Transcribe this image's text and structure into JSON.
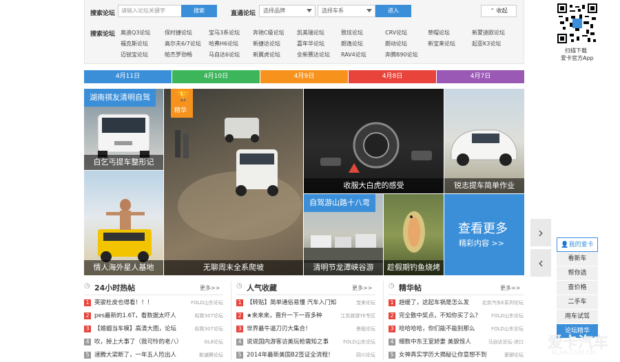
{
  "search": {
    "label": "搜索论坛",
    "placeholder": "请输入论坛关键字",
    "button": "搜索",
    "direct_label": "直通论坛",
    "brand_select": "选择品牌",
    "series_select": "选择车系",
    "enter_button": "进入",
    "collapse": "收起"
  },
  "recommend": {
    "label": "推荐论坛",
    "rows": [
      [
        "奥迪Q3论坛",
        "保时捷论坛",
        "宝马3系论坛",
        "奔驰C级论坛",
        "凯美瑞论坛",
        "致炫论坛",
        "CRV论坛",
        "草帽论坛",
        "新蒙迪欧论坛"
      ],
      [
        "福克斯论坛",
        "高尔夫6/7论坛",
        "哈弗H6论坛",
        "新捷达论坛",
        "嘉年华论坛",
        "朗逸论坛",
        "朗动论坛",
        "新宝来论坛",
        "起亚K3论坛"
      ],
      [
        "迈锐宝论坛",
        "帕杰罗劲畅",
        "马自达6论坛",
        "新翼虎论坛",
        "全新赛达论坛",
        "RAV4论坛",
        "奔腾B90论坛"
      ]
    ]
  },
  "qr": {
    "line1": "扫描下载",
    "line2": "爱卡官方App"
  },
  "date_tabs": [
    {
      "label": "4月11日",
      "color": "#3b8fd9"
    },
    {
      "label": "4月10日",
      "color": "#3cb55b"
    },
    {
      "label": "4月9日",
      "color": "#f7931d"
    },
    {
      "label": "4月8日",
      "color": "#e8443c"
    },
    {
      "label": "4月7日",
      "color": "#9b59b6"
    }
  ],
  "tiles": {
    "t1_label": "湖南祺友清明自驾",
    "t1_caption": "白乞丐提车整形记",
    "t2_caption": "情人海外星人基地",
    "t3_badge": "精华",
    "t3_caption": "无聊周末全系爬坡",
    "t4_caption": "收服大白虎的感受",
    "t5_caption": "锐志提车简单作业",
    "t6_label": "自驾游山路十八弯",
    "t6_caption": "清明节龙潭峡谷游",
    "t7_caption": "趁假期钓鱼烧烤",
    "more_title": "查看更多",
    "more_sub": "精彩内容 >>"
  },
  "sidebar": {
    "title": "我的爱卡",
    "items": [
      "看新车",
      "帮你选",
      "查价格",
      "二手车",
      "用车试驾",
      "论坛精华"
    ]
  },
  "lists": [
    {
      "title": "24小时热帖",
      "more": "更多>>",
      "items": [
        {
          "text": "英骏杜皮也得看！！！",
          "src": "FOLD山东论坛"
        },
        {
          "text": "pes最新的1.6T，看数据太吓人",
          "src": "标致307论坛"
        },
        {
          "text": "【婚姻当车模】高清大图，论坛",
          "src": "标致307论坛"
        },
        {
          "text": "吹，掉上大事了（我可怜的老八）",
          "src": "GL8论坛"
        },
        {
          "text": "速腾大梁断了，一年五人险出人",
          "src": "新速腾论坛"
        }
      ]
    },
    {
      "title": "人气收藏",
      "more": "更多>>",
      "items": [
        {
          "text": "【转贴】简单通俗易懂 汽车入门知",
          "src": "宝来论坛"
        },
        {
          "text": "★来来来，晋升一下一百多种",
          "src": "江苏旅游YE专区"
        },
        {
          "text": "世界最牛逼刀刃大集合！",
          "src": "景程论坛"
        },
        {
          "text": "说说国内游客访美玩枪需知之事",
          "src": "FOLD山东论坛"
        },
        {
          "text": "2014年最新美国B2签证全流程！",
          "src": "四川论坛"
        }
      ]
    },
    {
      "title": "精华帖",
      "more": "更多>>",
      "items": [
        {
          "text": "趟缓了，这起车祸是怎么发",
          "src": "北京汽车E系列论坛"
        },
        {
          "text": "完全散中奖点，不知你买了么？",
          "src": "FOLD山东论坛"
        },
        {
          "text": "哈哈哈哈，你们能不能别那么",
          "src": "FOLD山东论坛"
        },
        {
          "text": "细数中东王室娇妻 美貌惊人",
          "src": "马自达论坛-进口"
        },
        {
          "text": "女神真实学历大揭秘让你意想不到",
          "src": "爱聊论坛"
        }
      ]
    }
  ],
  "num_colors": [
    "#e8443c",
    "#e8443c",
    "#e8443c",
    "#999999",
    "#999999"
  ],
  "watermark": {
    "main": "爱卡汽车",
    "url": "XCAR.COM.CN"
  }
}
